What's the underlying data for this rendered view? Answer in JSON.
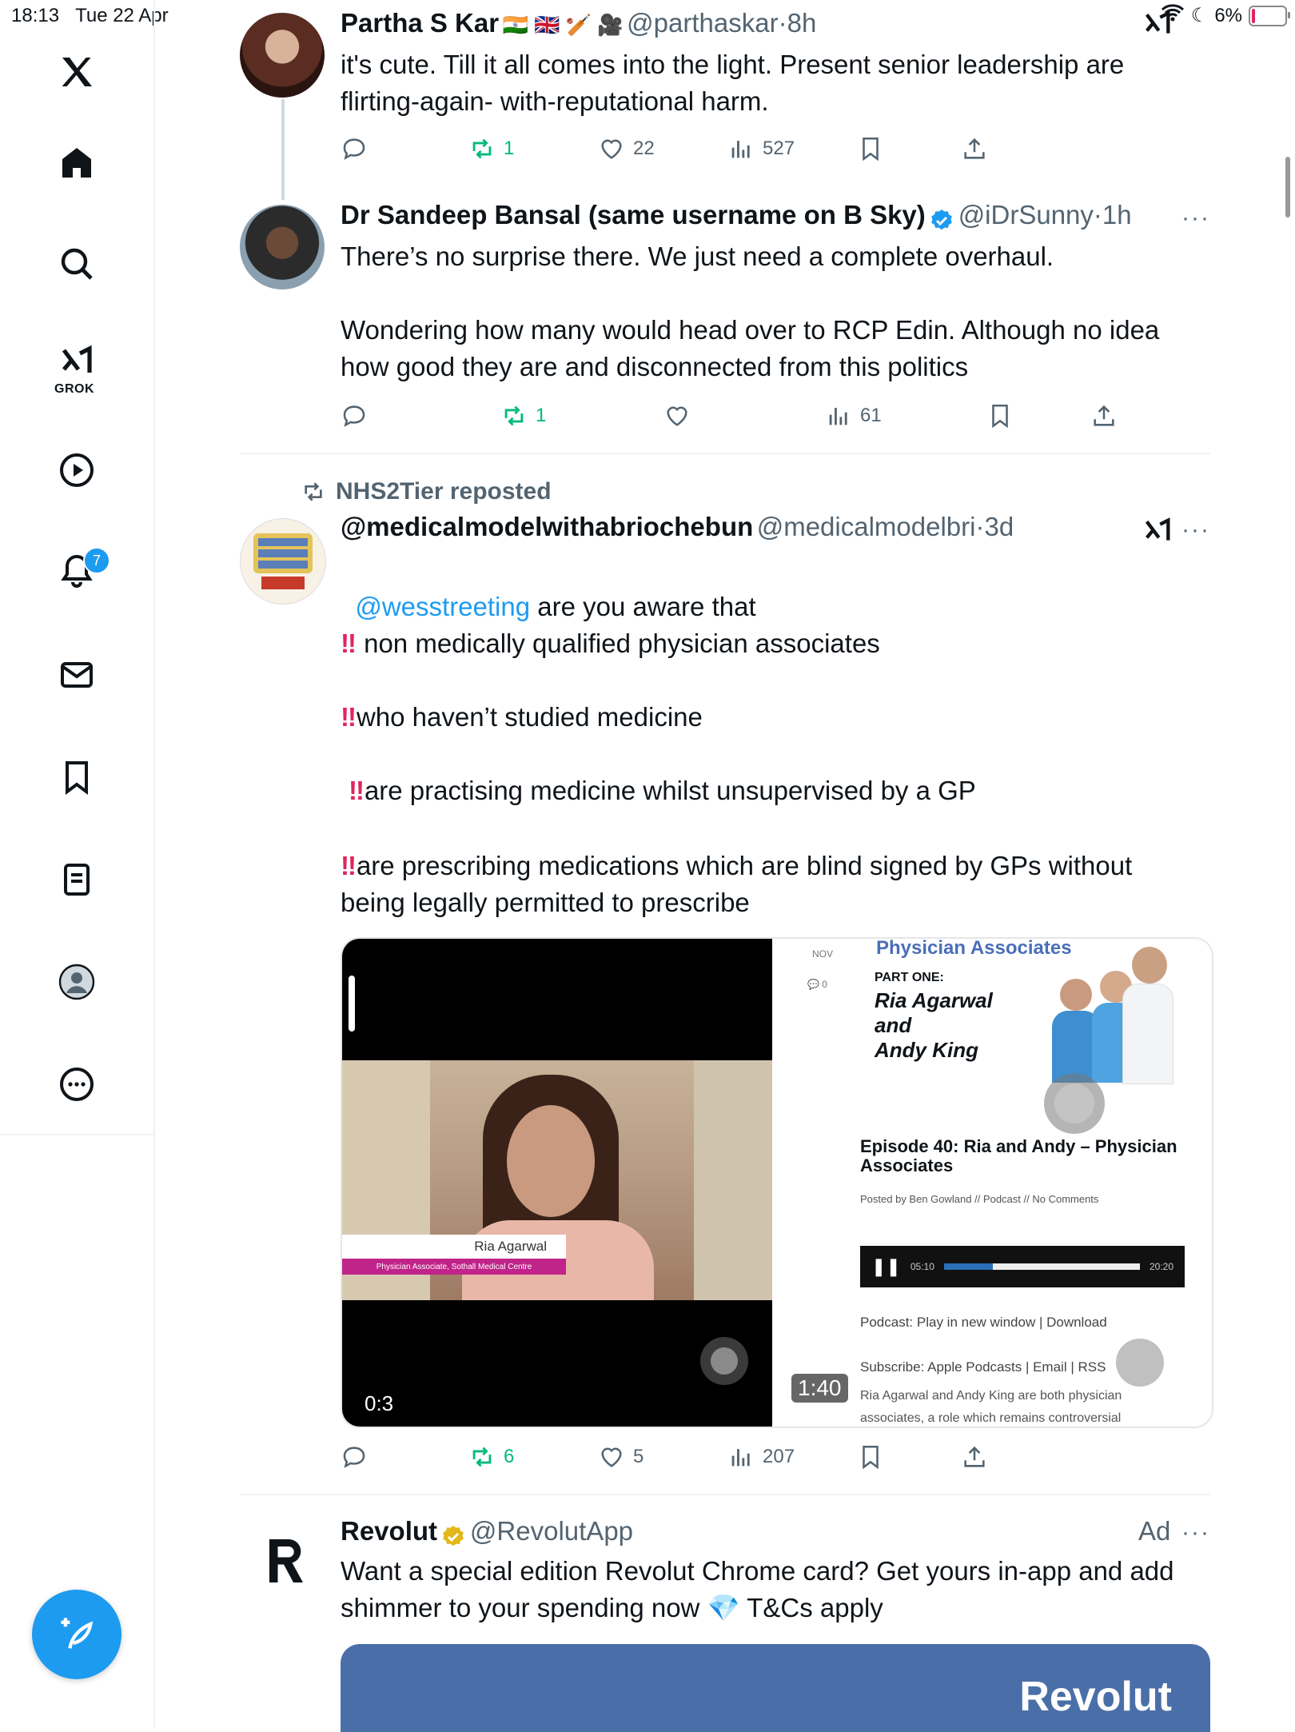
{
  "status_bar": {
    "time": "18:13",
    "date": "Tue 22 Apr",
    "battery": "6%"
  },
  "sidebar": {
    "items": [
      "home-icon",
      "search-icon",
      "grok-icon",
      "video-icon",
      "notifications-icon",
      "messages-icon",
      "bookmarks-icon",
      "lists-icon",
      "profile-icon",
      "more-icon"
    ],
    "grok_label": "GROK",
    "notifications_badge": "7"
  },
  "posts": [
    {
      "name": "Partha S Kar",
      "name_emoji": "🇮🇳 🇬🇧 🏏 🎥",
      "handle": "@parthaskar",
      "time": "8h",
      "text": "it's cute. Till it all comes into the light. Present senior leadership are\nflirting-again- with-reputational harm.",
      "reposts": "1",
      "likes": "22",
      "views": "527"
    },
    {
      "name": "Dr Sandeep Bansal (same username on B Sky)",
      "handle": "@iDrSunny",
      "time": "1h",
      "text": "There’s no surprise there. We just need a complete overhaul.\n\nWondering how many would head over to RCP Edin. Although no idea\nhow good they are and disconnected from this politics",
      "reposts": "1",
      "likes": "",
      "views": "61"
    },
    {
      "reposted_by": "NHS2Tier reposted",
      "name": "@medicalmodelwithabriochebun",
      "handle": "@medicalmodelbri",
      "time": "3d",
      "mention": "@wesstreeting",
      "lead": " are you aware that",
      "bullets": [
        " non medically qualified physician associates",
        "who haven’t studied medicine",
        "are practising medicine whilst unsupervised by a GP",
        "are prescribing medications which are blind signed by GPs without"
      ],
      "bullet_tail": "being legally permitted to prescribe",
      "video_time_left": "0:3",
      "video_time_right": "1:40",
      "caption_name": "Ria Agarwal",
      "caption_role": "Physician Associate, Sothall Medical Centre",
      "web": {
        "month": "NOV",
        "comments": "0",
        "title": "Physician Associates",
        "part": "PART ONE:",
        "names": "Ria Agarwal\nand\nAndy King",
        "episode": "Episode 40: Ria and Andy – Physician Associates",
        "posted": "Posted by Ben Gowland // Podcast // No Comments",
        "player_start": "05:10",
        "player_end": "20:20",
        "podcast_line": "Podcast: Play in new window | Download",
        "subscribe_line": "Subscribe: Apple Podcasts | Email | RSS",
        "blurb": "Ria Agarwal and Andy King are both physician\nassociates, a role which remains controversial"
      },
      "reposts": "6",
      "likes": "5",
      "views": "207"
    },
    {
      "name": "Revolut",
      "handle": "@RevolutApp",
      "ad_label": "Ad",
      "text": "Want a special edition Revolut Chrome card? Get yours in-app and add\nshimmer to your spending now 💎 T&Cs apply",
      "banner_text": "Revolut"
    }
  ],
  "colors": {
    "accent": "#1d9bf0",
    "repost_green": "#00ba7c",
    "muted": "#536471",
    "alert_red": "#e0245e"
  }
}
